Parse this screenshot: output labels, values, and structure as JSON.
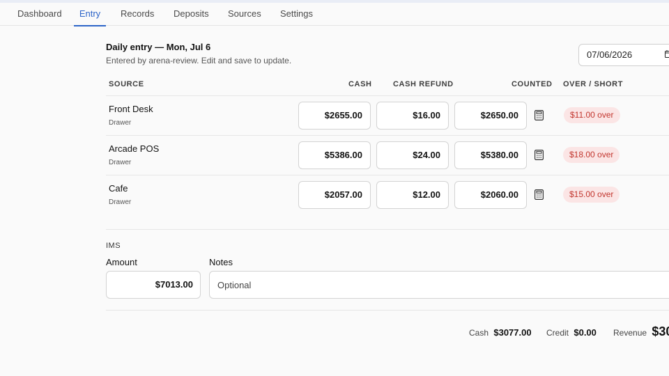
{
  "nav": {
    "tabs": [
      {
        "label": "Dashboard"
      },
      {
        "label": "Entry"
      },
      {
        "label": "Records"
      },
      {
        "label": "Deposits"
      },
      {
        "label": "Sources"
      },
      {
        "label": "Settings"
      }
    ],
    "active": "Entry"
  },
  "header": {
    "title": "Daily entry — Mon, Jul 6",
    "subtitle": "Entered by arena-review. Edit and save to update.",
    "date": "07/06/2026"
  },
  "columns": {
    "source": "SOURCE",
    "cash": "CASH",
    "refund": "CASH REFUND",
    "counted": "COUNTED",
    "over_short": "OVER / SHORT"
  },
  "rows": [
    {
      "name": "Front Desk",
      "type": "Drawer",
      "cash": "$2655.00",
      "refund": "$16.00",
      "counted": "$2650.00",
      "status": "$11.00 over"
    },
    {
      "name": "Arcade POS",
      "type": "Drawer",
      "cash": "$5386.00",
      "refund": "$24.00",
      "counted": "$5380.00",
      "status": "$18.00 over"
    },
    {
      "name": "Cafe",
      "type": "Drawer",
      "cash": "$2057.00",
      "refund": "$12.00",
      "counted": "$2060.00",
      "status": "$15.00 over"
    }
  ],
  "ims": {
    "section_label": "IMS",
    "amount_label": "Amount",
    "amount_value": "$7013.00",
    "notes_label": "Notes",
    "notes_placeholder": "Optional"
  },
  "summary": {
    "cash_label": "Cash",
    "cash_value": "$3077.00",
    "credit_label": "Credit",
    "credit_value": "$0.00",
    "revenue_label": "Revenue",
    "revenue_value": "$30"
  },
  "colors": {
    "accent": "#2c64c8",
    "over_badge_bg": "#fbe5e5",
    "over_badge_text": "#c2362e"
  },
  "icons": {
    "date_picker": "calendar-icon",
    "row_action": "calculator-icon"
  }
}
